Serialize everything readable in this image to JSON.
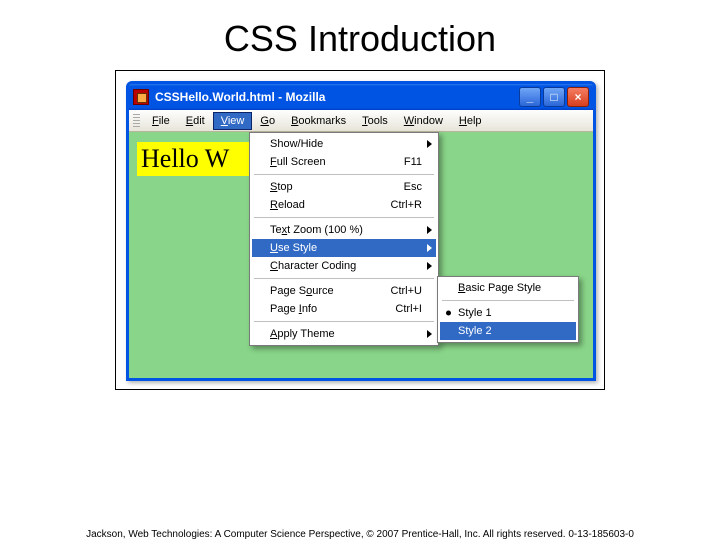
{
  "slide": {
    "title": "CSS Introduction"
  },
  "window": {
    "title": "CSSHello.World.html - Mozilla"
  },
  "menubar": {
    "file": "File",
    "edit": "Edit",
    "view": "View",
    "go": "Go",
    "bookmarks": "Bookmarks",
    "tools": "Tools",
    "window": "Window",
    "help": "Help"
  },
  "page": {
    "hello": "Hello W"
  },
  "viewMenu": {
    "showHide": "Show/Hide",
    "fullScreen": "Full Screen",
    "fullScreen_accel": "F11",
    "stop": "Stop",
    "stop_accel": "Esc",
    "reload": "Reload",
    "reload_accel": "Ctrl+R",
    "textZoom": "Text Zoom (100 %)",
    "useStyle": "Use Style",
    "charCoding": "Character Coding",
    "pageSource": "Page Source",
    "pageSource_accel": "Ctrl+U",
    "pageInfo": "Page Info",
    "pageInfo_accel": "Ctrl+I",
    "applyTheme": "Apply Theme"
  },
  "styleSub": {
    "basic": "Basic Page Style",
    "style1": "Style 1",
    "style2": "Style 2"
  },
  "footnote": "Jackson, Web Technologies: A Computer Science Perspective, © 2007 Prentice-Hall, Inc. All rights reserved. 0-13-185603-0"
}
